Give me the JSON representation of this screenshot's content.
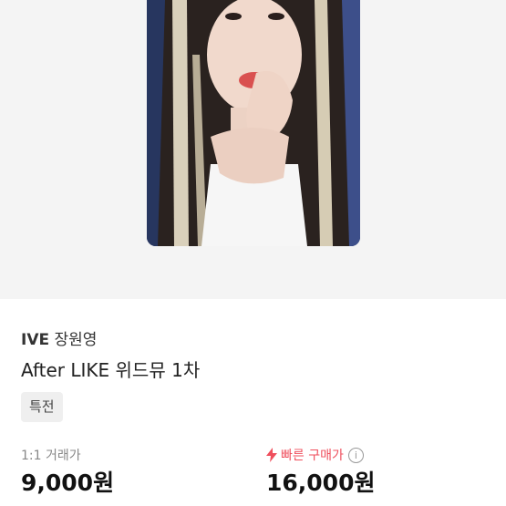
{
  "product": {
    "artist_group": "IVE",
    "artist_member": "장원영",
    "title": "After LIKE 위드뮤 1차",
    "tag": "특전"
  },
  "pricing": {
    "direct_label": "1:1 거래가",
    "direct_price": "9,000원",
    "fast_label": "빠른 구매가",
    "fast_price": "16,000원",
    "info_glyph": "i"
  },
  "colors": {
    "accent": "#ef4f5d",
    "hero_bg": "#f4f4f4"
  },
  "icons": {
    "fast": "lightning-bolt-icon",
    "info": "info-circle-icon"
  }
}
